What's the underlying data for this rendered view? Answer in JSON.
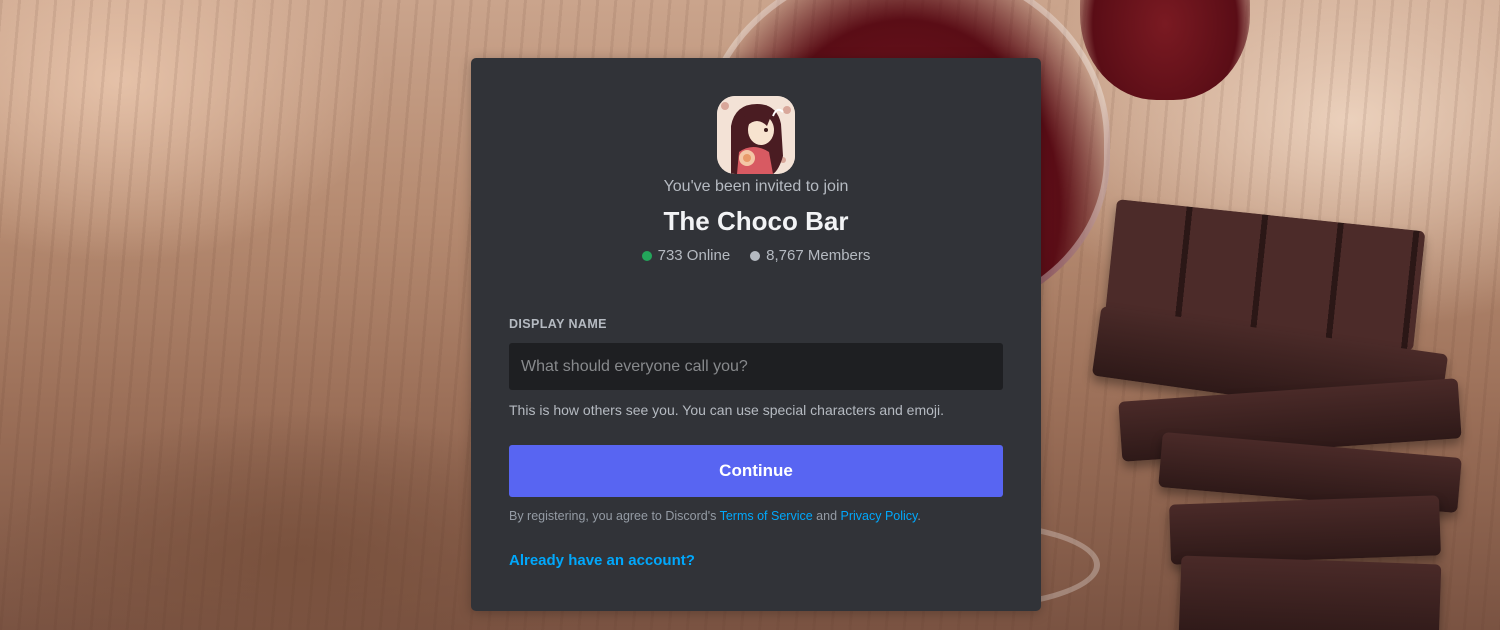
{
  "invite": {
    "intro": "You've been invited to join",
    "server_name": "The Choco Bar",
    "online": "733 Online",
    "members": "8,767 Members"
  },
  "form": {
    "label": "DISPLAY NAME",
    "placeholder": "What should everyone call you?",
    "value": "",
    "hint": "This is how others see you. You can use special characters and emoji.",
    "continue_label": "Continue"
  },
  "legal": {
    "prefix": "By registering, you agree to Discord's ",
    "tos": "Terms of Service",
    "and": " and ",
    "privacy": "Privacy Policy",
    "suffix": "."
  },
  "login_link": "Already have an account?",
  "colors": {
    "card": "#313338",
    "accent": "#5865f2",
    "link": "#00a8fc",
    "online": "#23a55a"
  },
  "icons": {
    "server": "server-avatar-anime-girl",
    "online_status": "online-dot-icon",
    "members_status": "members-dot-icon"
  }
}
